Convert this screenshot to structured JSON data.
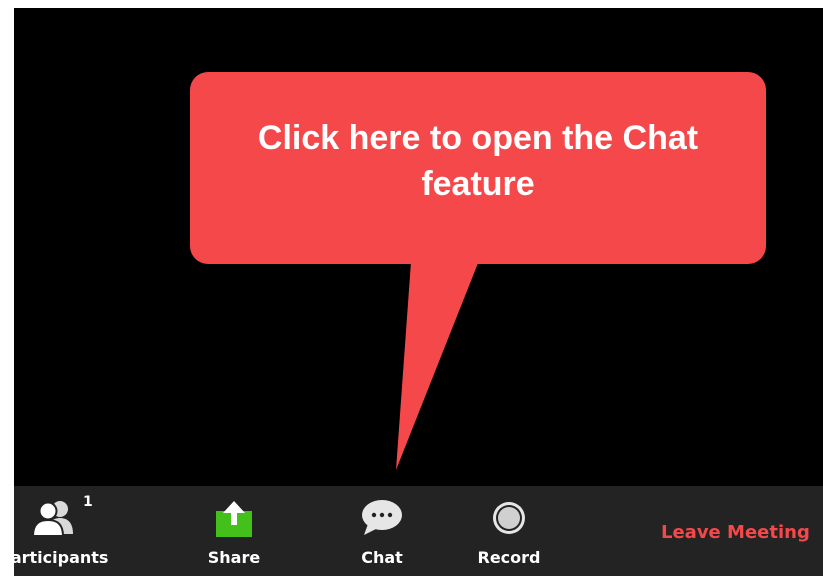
{
  "callout": {
    "text": "Click here to open the Chat feature",
    "color": "#f5484a"
  },
  "toolbar": {
    "participants": {
      "label": "Participants",
      "visible_label": "articipants",
      "count": "1",
      "icon": "participants-icon"
    },
    "share": {
      "label": "Share",
      "icon": "share-icon",
      "color": "#44c01a"
    },
    "chat": {
      "label": "Chat",
      "icon": "chat-bubble-icon"
    },
    "record": {
      "label": "Record",
      "icon": "record-icon"
    },
    "leave": {
      "label": "Leave Meeting",
      "color": "#f5484a"
    }
  }
}
